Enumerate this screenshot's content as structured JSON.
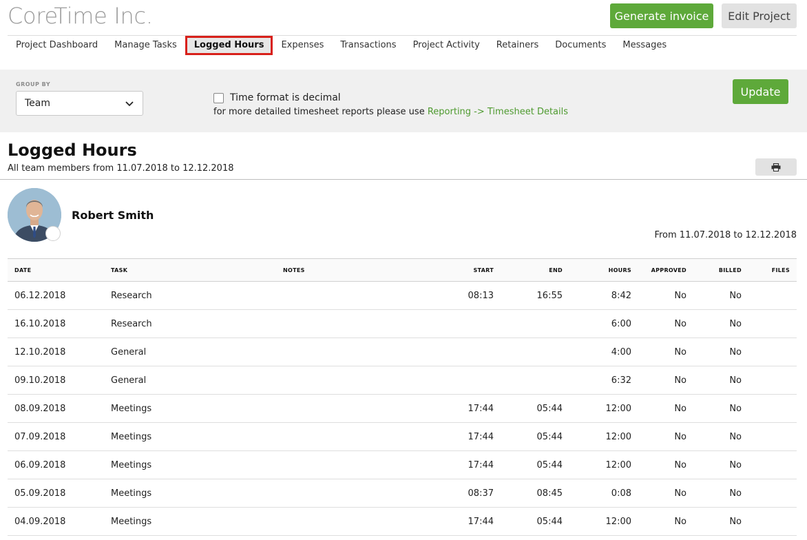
{
  "header": {
    "company": "CoreTime Inc.",
    "generate_label": "Generate invoice",
    "edit_label": "Edit Project"
  },
  "tabs": [
    {
      "label": "Project Dashboard",
      "active": false
    },
    {
      "label": "Manage Tasks",
      "active": false
    },
    {
      "label": "Logged Hours",
      "active": true
    },
    {
      "label": "Expenses",
      "active": false
    },
    {
      "label": "Transactions",
      "active": false
    },
    {
      "label": "Project Activity",
      "active": false
    },
    {
      "label": "Retainers",
      "active": false
    },
    {
      "label": "Documents",
      "active": false
    },
    {
      "label": "Messages",
      "active": false
    }
  ],
  "filters": {
    "group_by_label": "GROUP BY",
    "group_by_value": "Team",
    "decimal_label": "Time format is decimal",
    "decimal_checked": false,
    "hint_text": "for more detailed timesheet reports please use",
    "hint_link": "Reporting -> Timesheet Details",
    "update_label": "Update"
  },
  "report": {
    "title": "Logged Hours",
    "subtitle": "All team members from 11.07.2018 to 12.12.2018",
    "print_icon": "print-icon"
  },
  "member": {
    "name": "Robert Smith",
    "range": "From 11.07.2018 to 12.12.2018"
  },
  "table": {
    "headers": {
      "date": "DATE",
      "task": "TASK",
      "notes": "NOTES",
      "start": "START",
      "end": "END",
      "hours": "HOURS",
      "approved": "APPROVED",
      "billed": "BILLED",
      "files": "FILES"
    },
    "rows": [
      {
        "date": "06.12.2018",
        "task": "Research",
        "notes": "",
        "start": "08:13",
        "end": "16:55",
        "hours": "8:42",
        "approved": "No",
        "billed": "No",
        "files": ""
      },
      {
        "date": "16.10.2018",
        "task": "Research",
        "notes": "",
        "start": "",
        "end": "",
        "hours": "6:00",
        "approved": "No",
        "billed": "No",
        "files": ""
      },
      {
        "date": "12.10.2018",
        "task": "General",
        "notes": "",
        "start": "",
        "end": "",
        "hours": "4:00",
        "approved": "No",
        "billed": "No",
        "files": ""
      },
      {
        "date": "09.10.2018",
        "task": "General",
        "notes": "",
        "start": "",
        "end": "",
        "hours": "6:32",
        "approved": "No",
        "billed": "No",
        "files": ""
      },
      {
        "date": "08.09.2018",
        "task": "Meetings",
        "notes": "",
        "start": "17:44",
        "end": "05:44",
        "hours": "12:00",
        "approved": "No",
        "billed": "No",
        "files": ""
      },
      {
        "date": "07.09.2018",
        "task": "Meetings",
        "notes": "",
        "start": "17:44",
        "end": "05:44",
        "hours": "12:00",
        "approved": "No",
        "billed": "No",
        "files": ""
      },
      {
        "date": "06.09.2018",
        "task": "Meetings",
        "notes": "",
        "start": "17:44",
        "end": "05:44",
        "hours": "12:00",
        "approved": "No",
        "billed": "No",
        "files": ""
      },
      {
        "date": "05.09.2018",
        "task": "Meetings",
        "notes": "",
        "start": "08:37",
        "end": "08:45",
        "hours": "0:08",
        "approved": "No",
        "billed": "No",
        "files": ""
      },
      {
        "date": "04.09.2018",
        "task": "Meetings",
        "notes": "",
        "start": "17:44",
        "end": "05:44",
        "hours": "12:00",
        "approved": "No",
        "billed": "No",
        "files": ""
      }
    ]
  },
  "colors": {
    "accent": "#5ea93a",
    "link": "#4e9a2f",
    "active_tab_border": "#d8201a"
  }
}
